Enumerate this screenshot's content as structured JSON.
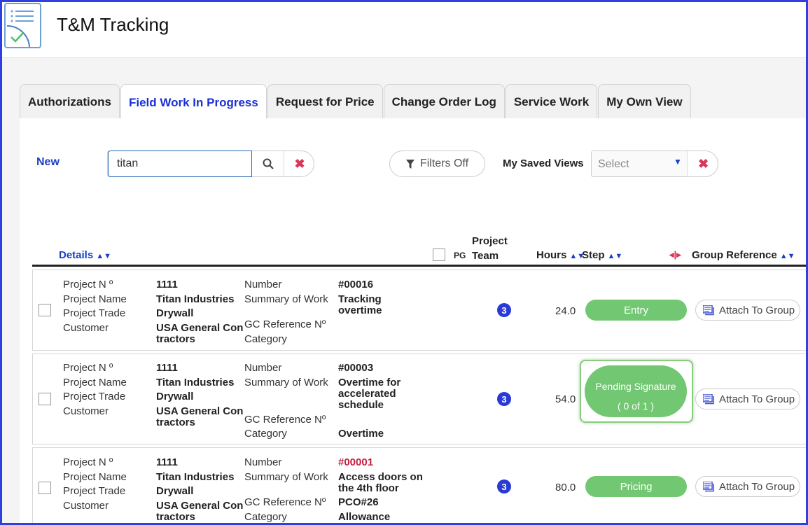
{
  "app": {
    "title": "T&M Tracking",
    "icon": "checklist-icon"
  },
  "tabs": [
    {
      "label": "Authorizations",
      "active": false
    },
    {
      "label": "Field Work In Progress",
      "active": true
    },
    {
      "label": "Request for Price",
      "active": false
    },
    {
      "label": "Change Order Log",
      "active": false
    },
    {
      "label": "Service Work",
      "active": false
    },
    {
      "label": "My Own View",
      "active": false
    }
  ],
  "toolbar": {
    "new_label": "New",
    "search_value": "titan",
    "filters_label": "Filters Off",
    "saved_views_label": "My Saved Views",
    "saved_views_placeholder": "Select"
  },
  "columns": {
    "details": "Details",
    "pg": "PG",
    "project_team": "Project Team",
    "hours": "Hours",
    "step": "Step",
    "group_reference": "Group Reference"
  },
  "field_labels": {
    "project_no": "Project N º",
    "project_name": "Project Name",
    "project_trade": "Project Trade",
    "customer": "Customer",
    "number": "Number",
    "summary": "Summary of Work",
    "gc_reference": "GC Reference Nº",
    "category": "Category"
  },
  "rows": [
    {
      "project_no": "1111",
      "project_name": "Titan Industries",
      "project_trade": "Drywall",
      "customer": [
        "USA General Con",
        "tractors"
      ],
      "number": "#00016",
      "summary": [
        "Tracking",
        "overtime"
      ],
      "gc_reference": "",
      "category": "",
      "team": "3",
      "hours": "24.0",
      "step": "Entry",
      "attach_label": "Attach To Group"
    },
    {
      "project_no": "1111",
      "project_name": "Titan Industries",
      "project_trade": "Drywall",
      "customer": [
        "USA General Con",
        "tractors"
      ],
      "number": "#00003",
      "summary": [
        "Overtime for",
        "accelerated",
        "schedule"
      ],
      "gc_reference": "",
      "category": "Overtime",
      "team": "3",
      "hours": "54.0",
      "step": "Pending Signature",
      "step_sub": "( 0 of 1 )",
      "attach_label": "Attach To Group"
    },
    {
      "project_no": "1111",
      "project_name": "Titan Industries",
      "project_trade": "Drywall",
      "customer": [
        "USA General Con",
        "tractors"
      ],
      "number": "#00001",
      "summary": [
        "Access doors on",
        "the 4th floor"
      ],
      "gc_reference": "PCO#26",
      "category": "Allowance",
      "team": "3",
      "hours": "80.0",
      "step": "Pricing",
      "attach_label": "Attach To Group"
    }
  ],
  "colors": {
    "accent": "#1a2fd6",
    "frame": "#2f3fe0",
    "step_green": "#72c772",
    "danger": "#d9365a"
  }
}
